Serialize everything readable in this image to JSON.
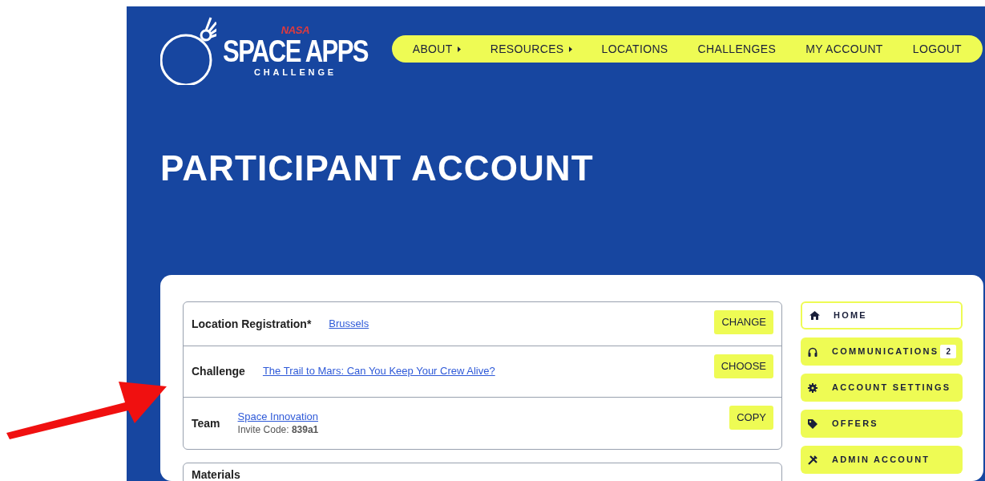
{
  "logo": {
    "agency": "NASA",
    "name": "SPACE APPS",
    "subtitle": "CHALLENGE"
  },
  "nav": [
    {
      "label": "ABOUT",
      "dropdown": true
    },
    {
      "label": "RESOURCES",
      "dropdown": true
    },
    {
      "label": "LOCATIONS",
      "dropdown": false
    },
    {
      "label": "CHALLENGES",
      "dropdown": false
    },
    {
      "label": "MY ACCOUNT",
      "dropdown": false
    },
    {
      "label": "LOGOUT",
      "dropdown": false
    }
  ],
  "page_title": "PARTICIPANT ACCOUNT",
  "registration_rows": [
    {
      "label": "Location Registration*",
      "link": "Brussels",
      "button": "CHANGE"
    },
    {
      "label": "Challenge",
      "link": "The Trail to Mars: Can You Keep Your Crew Alive?",
      "button": "CHOOSE"
    },
    {
      "label": "Team",
      "link": "Space Innovation",
      "detail_label": "Invite Code:",
      "detail_value": "839a1",
      "button": "COPY"
    }
  ],
  "materials": {
    "title": "Materials"
  },
  "sidebar": {
    "items": [
      {
        "kind": "home",
        "label": "HOME",
        "selected": true
      },
      {
        "kind": "headset",
        "label": "COMMUNICATIONS",
        "badge": "2",
        "selected": false
      },
      {
        "kind": "gear",
        "label": "ACCOUNT SETTINGS",
        "selected": false
      },
      {
        "kind": "tag",
        "label": "OFFERS",
        "selected": false
      },
      {
        "kind": "tools",
        "label": "ADMIN ACCOUNT",
        "selected": false
      }
    ]
  }
}
